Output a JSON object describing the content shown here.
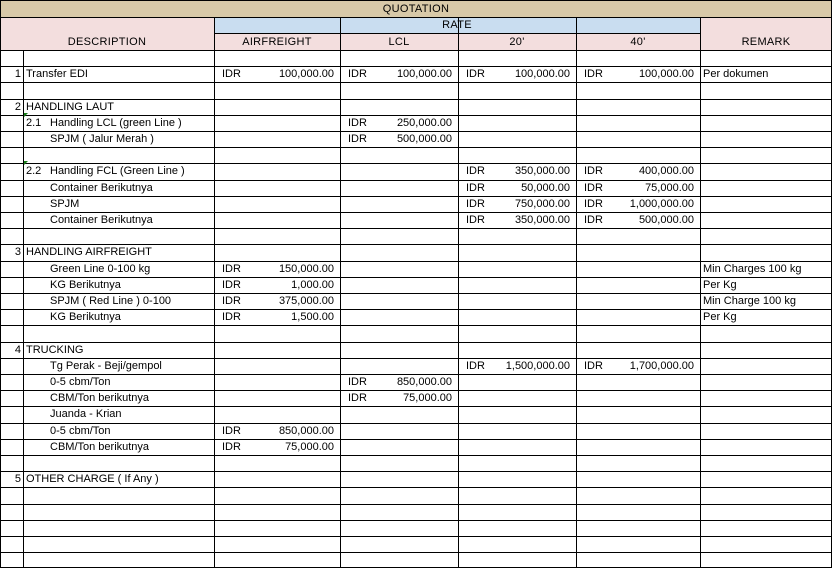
{
  "header": {
    "title": "QUOTATION",
    "rate": "RATE",
    "columns": {
      "description": "DESCRIPTION",
      "airfreight": "AIRFREIGHT",
      "lcl": "LCL",
      "c20": "20'",
      "c40": "40'",
      "remark": "REMARK"
    }
  },
  "colors": {
    "title_band": "#d8c9a8",
    "rate_band": "#c9ddf0",
    "header_band": "#f3dede",
    "grid": "#000000",
    "comment_marker": "#1a7f1a"
  },
  "rows": [
    {
      "no": "",
      "code": "",
      "desc": "",
      "indent": 0
    },
    {
      "no": "1",
      "code": "",
      "desc": "Transfer EDI",
      "indent": 0,
      "air": [
        "IDR",
        "100,000.00"
      ],
      "lcl": [
        "IDR",
        "100,000.00"
      ],
      "c20": [
        "IDR",
        "100,000.00"
      ],
      "c40": [
        "IDR",
        "100,000.00"
      ],
      "remark": "Per dokumen"
    },
    {
      "no": "",
      "code": "",
      "desc": "",
      "indent": 0
    },
    {
      "no": "2",
      "code": "",
      "desc": "HANDLING LAUT",
      "indent": 0
    },
    {
      "no": "",
      "code": "2.1",
      "desc": "Handling LCL (green Line )",
      "indent": 1,
      "marker": true,
      "lcl": [
        "IDR",
        "250,000.00"
      ]
    },
    {
      "no": "",
      "code": "",
      "desc": "SPJM ( Jalur Merah )",
      "indent": 2,
      "lcl": [
        "IDR",
        "500,000.00"
      ]
    },
    {
      "no": "",
      "code": "",
      "desc": "",
      "indent": 0
    },
    {
      "no": "",
      "code": "2.2",
      "desc": "Handling FCL (Green Line )",
      "indent": 1,
      "marker": true,
      "c20": [
        "IDR",
        "350,000.00"
      ],
      "c40": [
        "IDR",
        "400,000.00"
      ]
    },
    {
      "no": "",
      "code": "",
      "desc": "Container Berikutnya",
      "indent": 2,
      "c20": [
        "IDR",
        "50,000.00"
      ],
      "c40": [
        "IDR",
        "75,000.00"
      ]
    },
    {
      "no": "",
      "code": "",
      "desc": "SPJM",
      "indent": 2,
      "c20": [
        "IDR",
        "750,000.00"
      ],
      "c40": [
        "IDR",
        "1,000,000.00"
      ]
    },
    {
      "no": "",
      "code": "",
      "desc": "Container Berikutnya",
      "indent": 2,
      "c20": [
        "IDR",
        "350,000.00"
      ],
      "c40": [
        "IDR",
        "500,000.00"
      ]
    },
    {
      "no": "",
      "code": "",
      "desc": "",
      "indent": 0
    },
    {
      "no": "3",
      "code": "",
      "desc": "HANDLING AIRFREIGHT",
      "indent": 0
    },
    {
      "no": "",
      "code": "",
      "desc": "Green Line 0-100 kg",
      "indent": 2,
      "air": [
        "IDR",
        "150,000.00"
      ],
      "remark": "Min Charges 100 kg"
    },
    {
      "no": "",
      "code": "",
      "desc": "KG Berikutnya",
      "indent": 2,
      "air": [
        "IDR",
        "1,000.00"
      ],
      "remark": "Per Kg"
    },
    {
      "no": "",
      "code": "",
      "desc": "SPJM ( Red Line ) 0-100",
      "indent": 2,
      "air": [
        "IDR",
        "375,000.00"
      ],
      "remark": "Min Charge 100 kg"
    },
    {
      "no": "",
      "code": "",
      "desc": "KG Berikutnya",
      "indent": 2,
      "air": [
        "IDR",
        "1,500.00"
      ],
      "remark": "Per Kg"
    },
    {
      "no": "",
      "code": "",
      "desc": "",
      "indent": 0
    },
    {
      "no": "4",
      "code": "",
      "desc": "TRUCKING",
      "indent": 0
    },
    {
      "no": "",
      "code": "",
      "desc": "Tg Perak - Beji/gempol",
      "indent": 2,
      "c20": [
        "IDR",
        "1,500,000.00"
      ],
      "c40": [
        "IDR",
        "1,700,000.00"
      ]
    },
    {
      "no": "",
      "code": "",
      "desc": "0-5 cbm/Ton",
      "indent": 2,
      "lcl": [
        "IDR",
        "850,000.00"
      ]
    },
    {
      "no": "",
      "code": "",
      "desc": "CBM/Ton berikutnya",
      "indent": 2,
      "lcl": [
        "IDR",
        "75,000.00"
      ]
    },
    {
      "no": "",
      "code": "",
      "desc": "Juanda - Krian",
      "indent": 2
    },
    {
      "no": "",
      "code": "",
      "desc": "0-5 cbm/Ton",
      "indent": 2,
      "air": [
        "IDR",
        "850,000.00"
      ]
    },
    {
      "no": "",
      "code": "",
      "desc": "CBM/Ton berikutnya",
      "indent": 2,
      "air": [
        "IDR",
        "75,000.00"
      ]
    },
    {
      "no": "",
      "code": "",
      "desc": "",
      "indent": 0
    },
    {
      "no": "5",
      "code": "",
      "desc": "OTHER CHARGE ( If Any )",
      "indent": 0
    },
    {
      "no": "",
      "code": "",
      "desc": "",
      "indent": 0
    },
    {
      "no": "",
      "code": "",
      "desc": "",
      "indent": 0
    },
    {
      "no": "",
      "code": "",
      "desc": "",
      "indent": 0
    },
    {
      "no": "",
      "code": "",
      "desc": "",
      "indent": 0
    }
  ]
}
